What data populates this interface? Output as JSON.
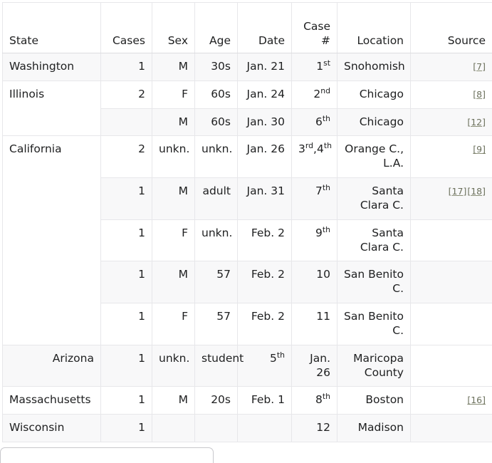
{
  "table": {
    "columns": [
      {
        "key": "state",
        "label": "State",
        "align": "left"
      },
      {
        "key": "cases",
        "label": "Cases",
        "align": "right"
      },
      {
        "key": "sex",
        "label": "Sex",
        "align": "right"
      },
      {
        "key": "age",
        "label": "Age",
        "align": "right"
      },
      {
        "key": "date",
        "label": "Date",
        "align": "right"
      },
      {
        "key": "casenum",
        "label": "Case #",
        "align": "right"
      },
      {
        "key": "location",
        "label": "Location",
        "align": "right"
      },
      {
        "key": "source",
        "label": "Source",
        "align": "right"
      }
    ],
    "rows": [
      {
        "state": "Washington",
        "state_rowspan": 1,
        "cases": "1",
        "sex": "M",
        "age": "30s",
        "date": "Jan. 21",
        "casenum": "1",
        "casenum_ord": "st",
        "location": "Snohomish",
        "citations": [
          "[7]"
        ]
      },
      {
        "state": "Illinois",
        "state_rowspan": 2,
        "cases": "2",
        "sex": "F",
        "age": "60s",
        "date": "Jan. 24",
        "casenum": "2",
        "casenum_ord": "nd",
        "location": "Chicago",
        "citations": [
          "[8]"
        ]
      },
      {
        "state": null,
        "state_rowspan": 0,
        "cases": "",
        "sex": "M",
        "age": "60s",
        "date": "Jan. 30",
        "casenum": "6",
        "casenum_ord": "th",
        "location": "Chicago",
        "citations": [
          "[12]"
        ]
      },
      {
        "state": "California",
        "state_rowspan": 5,
        "cases": "2",
        "sex": "unkn.",
        "age": "unkn.",
        "date": "Jan. 26",
        "casenum": "3",
        "casenum_ord": "rd",
        "casenum2": "4",
        "casenum2_ord": "th",
        "casenum_sep": ",",
        "location": "Orange C., L.A.",
        "citations": [
          "[9]"
        ]
      },
      {
        "state": null,
        "state_rowspan": 0,
        "cases": "1",
        "sex": "M",
        "age": "adult",
        "date": "Jan. 31",
        "casenum": "7",
        "casenum_ord": "th",
        "location": "Santa Clara C.",
        "citations": [
          "[17]",
          "[18]"
        ]
      },
      {
        "state": null,
        "state_rowspan": 0,
        "cases": "1",
        "sex": "F",
        "age": "unkn.",
        "date": "Feb. 2",
        "casenum": "9",
        "casenum_ord": "th",
        "location": "Santa Clara C.",
        "citations": []
      },
      {
        "state": null,
        "state_rowspan": 0,
        "cases": "1",
        "sex": "M",
        "age": "57",
        "date": "Feb. 2",
        "casenum": "10",
        "casenum_ord": "",
        "location": "San Benito C.",
        "citations": []
      },
      {
        "state": null,
        "state_rowspan": 0,
        "cases": "1",
        "sex": "F",
        "age": "57",
        "date": "Feb. 2",
        "casenum": "11",
        "casenum_ord": "",
        "location": "San Benito C.",
        "citations": []
      },
      {
        "state": null,
        "state_rowspan": 0,
        "cases": "Arizona",
        "sex": "1",
        "age": "unkn.",
        "date": "student",
        "casenum": "5",
        "casenum_ord": "th",
        "location": "Jan. 26",
        "source_text": "Maricopa County",
        "citations": []
      },
      {
        "state": "Massachusetts",
        "state_rowspan": 1,
        "cases": "1",
        "sex": "M",
        "age": "20s",
        "date": "Feb. 1",
        "casenum": "8",
        "casenum_ord": "th",
        "location": "Boston",
        "citations": [
          "[16]"
        ]
      },
      {
        "state": "Wisconsin",
        "state_rowspan": 1,
        "cases": "1",
        "sex": "",
        "age": "",
        "date": "",
        "casenum": "12",
        "casenum_ord": "",
        "location": "Madison",
        "citations": []
      }
    ]
  },
  "colors": {
    "citation_link": "#6b705c",
    "row_stripe": "#f8f8f9",
    "row_plain": "#ffffff",
    "cell_border": "#e7e7ea",
    "text": "#202122"
  }
}
